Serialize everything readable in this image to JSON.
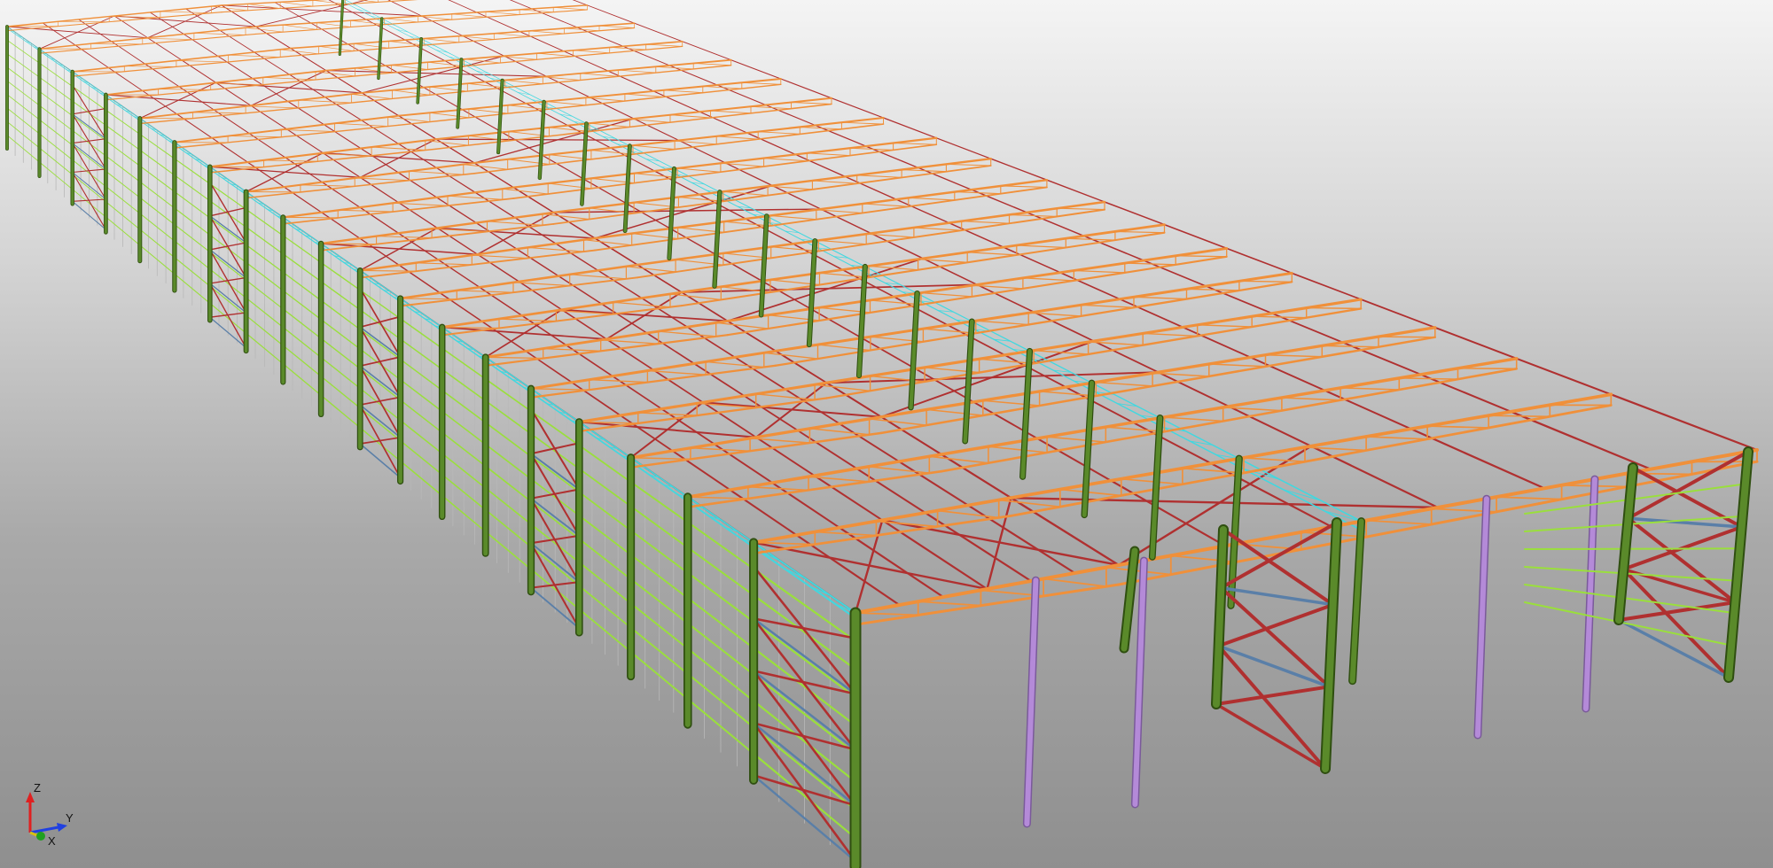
{
  "viewport": {
    "view_type": "3d-structural-model",
    "background": {
      "top": "#f4f4f4",
      "bottom": "#8f8f8f"
    }
  },
  "model": {
    "frames_along_length": 20,
    "colors": {
      "columns": "#5a8a2a",
      "column_edge": "#2f4f10",
      "roof_truss": "#f0903a",
      "purlins_bracing": "#b03030",
      "eave_strut": "#40d8e0",
      "wall_girts": "#9adf3c",
      "wall_bracing_blue": "#5a7fa8",
      "interior_columns": "#b48ad8",
      "cladding_lines": "#b8b8b8"
    }
  },
  "axis_triad": {
    "z_label": "Z",
    "y_label": "Y",
    "x_label": "X",
    "z_color": "#e02020",
    "y_color": "#2040e0",
    "x_color": "#20a020"
  }
}
